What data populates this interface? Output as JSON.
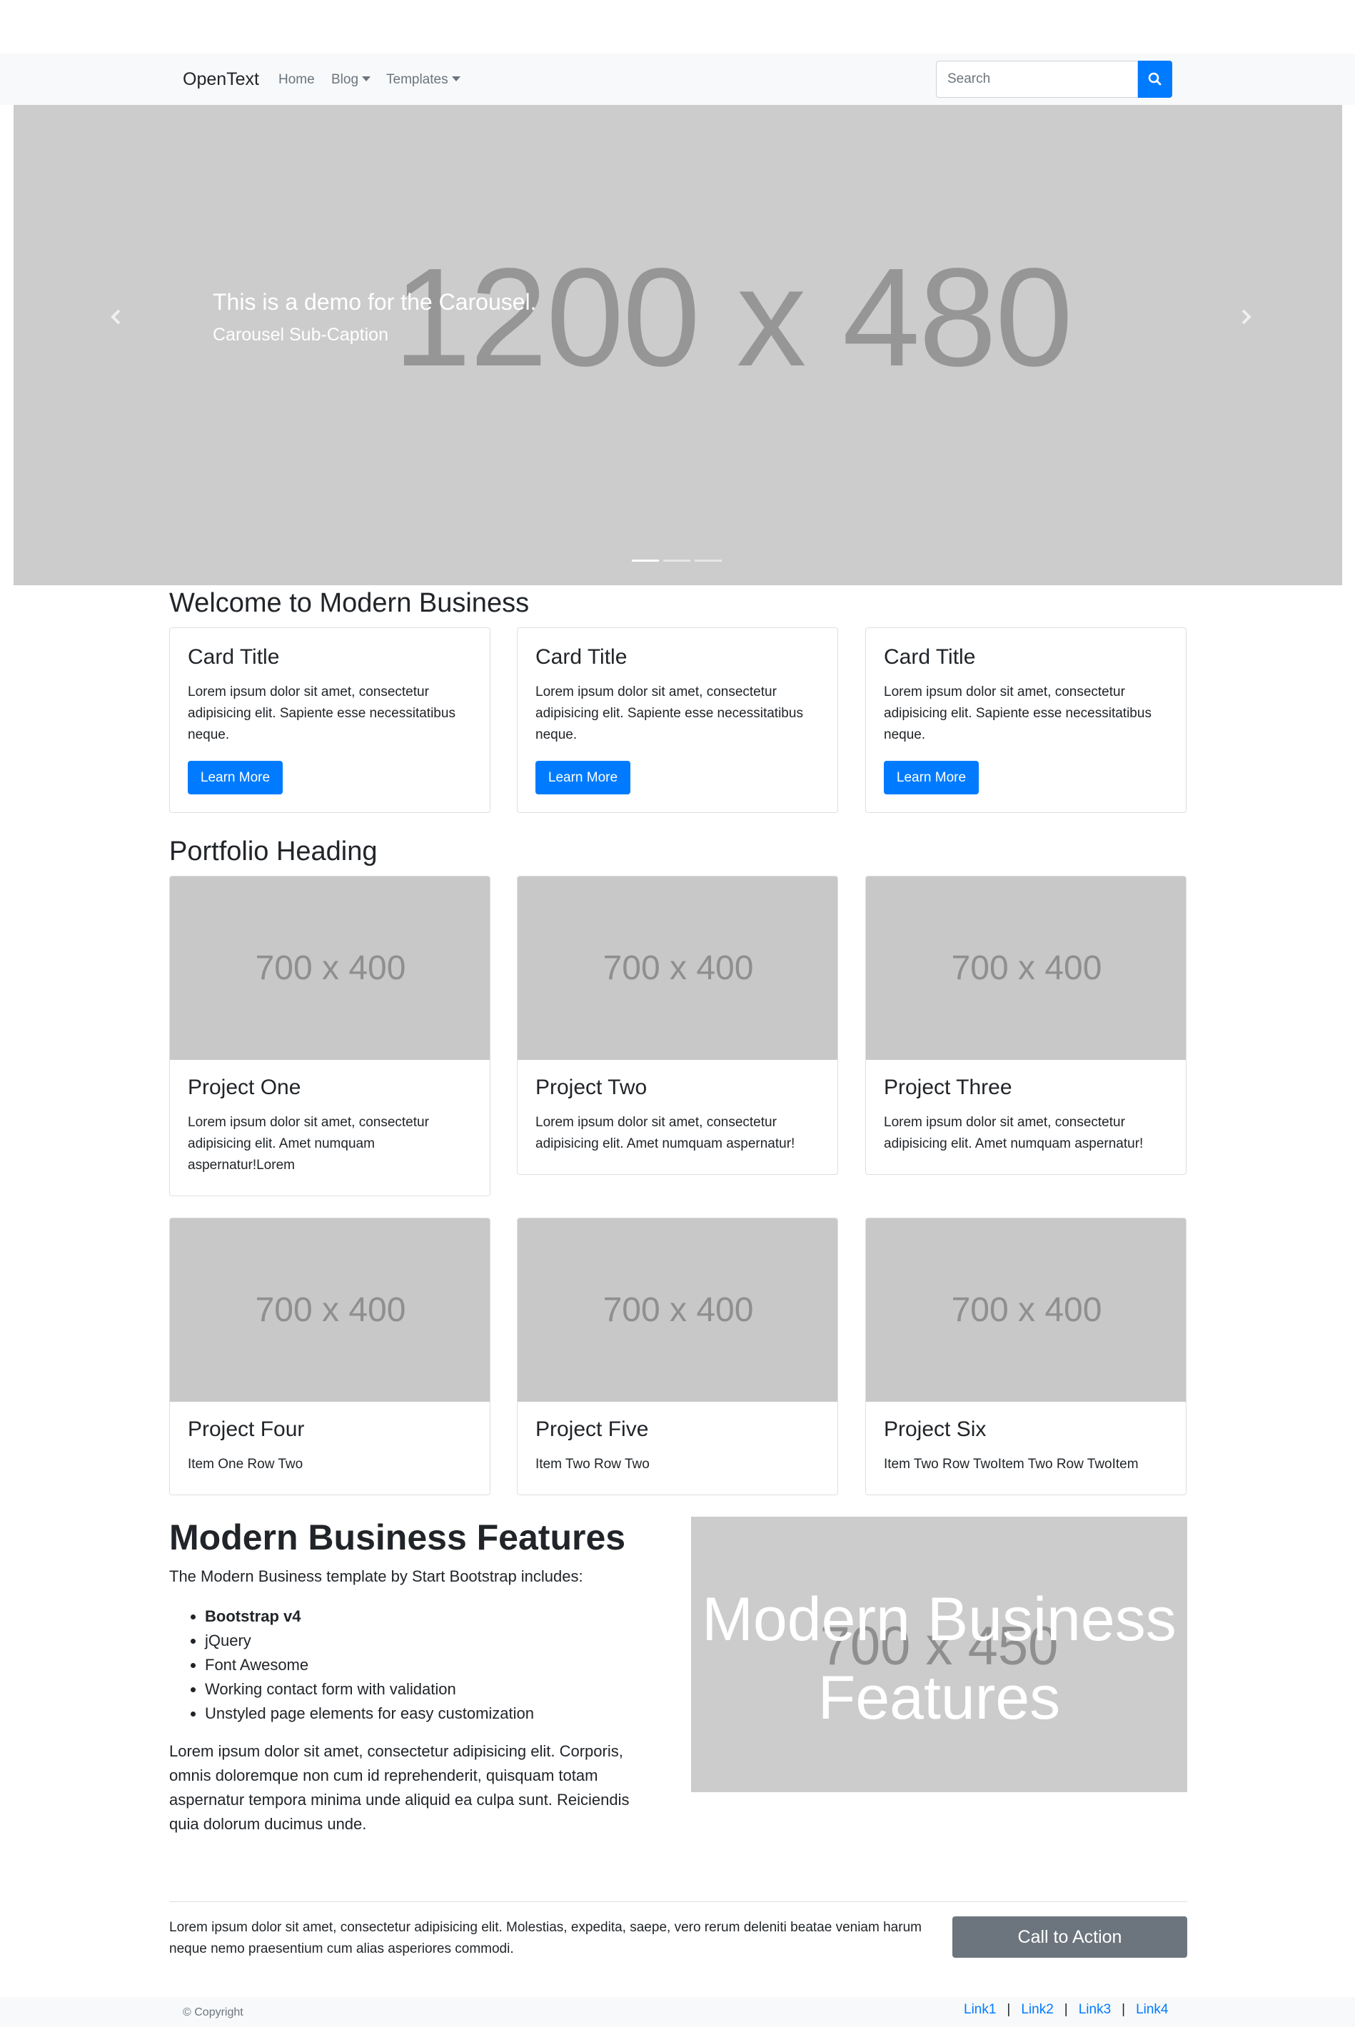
{
  "navbar": {
    "brand": "OpenText",
    "links": [
      {
        "label": "Home"
      },
      {
        "label": "Blog"
      },
      {
        "label": "Templates"
      }
    ],
    "search_placeholder": "Search"
  },
  "carousel": {
    "placeholder_text": "1200 x 480",
    "caption_title": "This is a demo for the Carousel.",
    "caption_sub": "Carousel Sub-Caption",
    "indicator_count": 3,
    "active_indicator": 0
  },
  "welcome": {
    "heading": "Welcome to Modern Business",
    "cards": [
      {
        "title": "Card Title",
        "text": "Lorem ipsum dolor sit amet, consectetur adipisicing elit. Sapiente esse necessitatibus neque.",
        "button": "Learn More"
      },
      {
        "title": "Card Title",
        "text": "Lorem ipsum dolor sit amet, consectetur adipisicing elit. Sapiente esse necessitatibus neque.",
        "button": "Learn More"
      },
      {
        "title": "Card Title",
        "text": "Lorem ipsum dolor sit amet, consectetur adipisicing elit. Sapiente esse necessitatibus neque.",
        "button": "Learn More"
      }
    ]
  },
  "portfolio": {
    "heading": "Portfolio Heading",
    "image_placeholder": "700 x 400",
    "items": [
      {
        "title": "Project One",
        "text": "Lorem ipsum dolor sit amet, consectetur adipisicing elit. Amet numquam aspernatur!Lorem"
      },
      {
        "title": "Project Two",
        "text": "Lorem ipsum dolor sit amet, consectetur adipisicing elit. Amet numquam aspernatur!"
      },
      {
        "title": "Project Three",
        "text": "Lorem ipsum dolor sit amet, consectetur adipisicing elit. Amet numquam aspernatur!"
      },
      {
        "title": "Project Four",
        "text": "Item One Row Two"
      },
      {
        "title": "Project Five",
        "text": "Item Two Row Two"
      },
      {
        "title": "Project Six",
        "text": "Item Two Row TwoItem Two Row TwoItem"
      }
    ]
  },
  "features": {
    "heading": "Modern Business Features",
    "intro": "The Modern Business template by Start Bootstrap includes:",
    "list": [
      {
        "text": "Bootstrap v4",
        "bold": true
      },
      {
        "text": "jQuery",
        "bold": false
      },
      {
        "text": "Font Awesome",
        "bold": false
      },
      {
        "text": "Working contact form with validation",
        "bold": false
      },
      {
        "text": "Unstyled page elements for easy customization",
        "bold": false
      }
    ],
    "paragraph": "Lorem ipsum dolor sit amet, consectetur adipisicing elit. Corporis, omnis doloremque non cum id reprehenderit, quisquam totam aspernatur tempora minima unde aliquid ea culpa sunt. Reiciendis quia dolorum ducimus unde.",
    "image_placeholder": "700 x 450",
    "image_overlay_line1": "Modern Business",
    "image_overlay_line2": "Features"
  },
  "cta": {
    "text": "Lorem ipsum dolor sit amet, consectetur adipisicing elit. Molestias, expedita, saepe, vero rerum deleniti beatae veniam harum neque nemo praesentium cum alias asperiores commodi.",
    "button": "Call to Action"
  },
  "footer": {
    "copyright": "© Copyright",
    "links": [
      "Link1",
      "Link2",
      "Link3",
      "Link4"
    ],
    "separator": "|"
  },
  "colors": {
    "primary": "#007bff",
    "secondary": "#6c757d",
    "navbar_bg": "#f8f9fa",
    "placeholder_bg": "#cccccc"
  }
}
